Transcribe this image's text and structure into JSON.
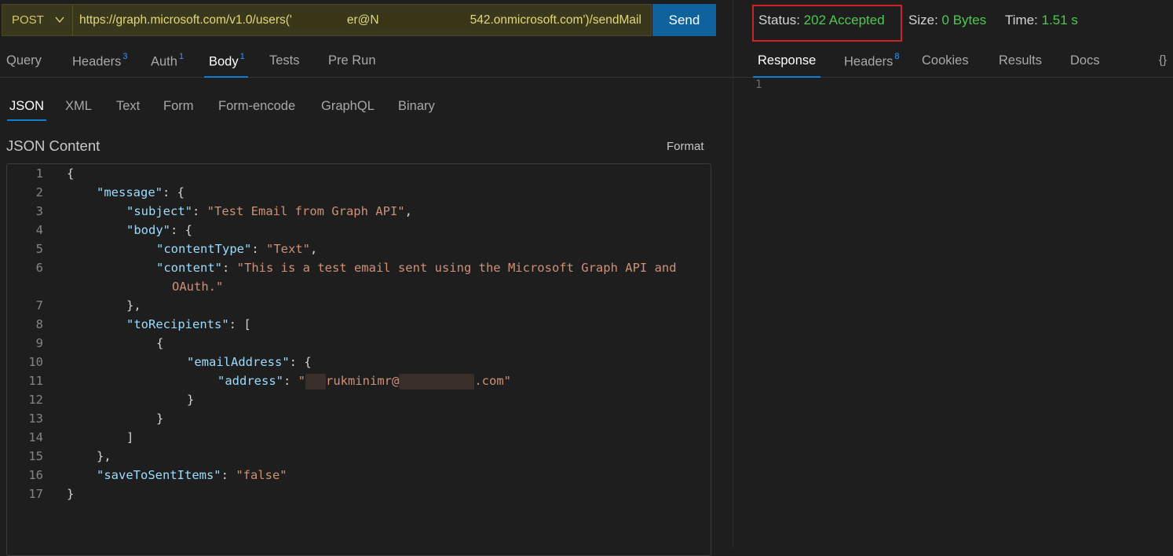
{
  "request": {
    "method": "POST",
    "url_prefix": "https://graph.microsoft.com/v1.0/users('",
    "url_middle1": "er@N",
    "url_middle2": "542.onmicrosoft.com')/sendMail",
    "send_label": "Send"
  },
  "tabs": [
    {
      "label": "Query",
      "badge": ""
    },
    {
      "label": "Headers",
      "badge": "3"
    },
    {
      "label": "Auth",
      "badge": "1"
    },
    {
      "label": "Body",
      "badge": "1"
    },
    {
      "label": "Tests",
      "badge": ""
    },
    {
      "label": "Pre Run",
      "badge": ""
    }
  ],
  "body_tabs": [
    "JSON",
    "XML",
    "Text",
    "Form",
    "Form-encode",
    "GraphQL",
    "Binary"
  ],
  "editor": {
    "title": "JSON Content",
    "format_label": "Format",
    "line_numbers": [
      "1",
      "2",
      "3",
      "4",
      "5",
      "6",
      "7",
      "8",
      "9",
      "10",
      "11",
      "12",
      "13",
      "14",
      "15",
      "16",
      "17"
    ],
    "l1": "{",
    "l2_key": "\"message\"",
    "l2_rest": ": {",
    "l3_key": "\"subject\"",
    "l3_sep": ": ",
    "l3_val": "\"Test Email from Graph API\"",
    "l3_end": ",",
    "l4_key": "\"body\"",
    "l4_rest": ": {",
    "l5_key": "\"contentType\"",
    "l5_sep": ": ",
    "l5_val": "\"Text\"",
    "l5_end": ",",
    "l6_key": "\"content\"",
    "l6_sep": ": ",
    "l6_val": "\"This is a test email sent using the Microsoft Graph API and",
    "l6_wrap": "OAuth.\"",
    "l7": "},",
    "l8_key": "\"toRecipients\"",
    "l8_rest": ": [",
    "l9": "{",
    "l10_key": "\"emailAddress\"",
    "l10_rest": ": {",
    "l11_key": "\"address\"",
    "l11_sep": ": ",
    "l11_q": "\"",
    "l11_mid": "rukminimr@",
    "l11_end": ".com\"",
    "l12": "}",
    "l13": "}",
    "l14": "]",
    "l15": "},",
    "l16_key": "\"saveToSentItems\"",
    "l16_sep": ": ",
    "l16_val": "\"false\"",
    "l17": "}"
  },
  "response": {
    "status_label": "Status:",
    "status_value": "202 Accepted",
    "size_label": "Size:",
    "size_value": "0 Bytes",
    "time_label": "Time:",
    "time_value": "1.51 s",
    "tabs": [
      {
        "label": "Response",
        "badge": ""
      },
      {
        "label": "Headers",
        "badge": "8"
      },
      {
        "label": "Cookies",
        "badge": ""
      },
      {
        "label": "Results",
        "badge": ""
      },
      {
        "label": "Docs",
        "badge": ""
      }
    ],
    "braces_label": "{}",
    "line_1": "1"
  },
  "colors": {
    "accent": "#0e639c",
    "status_ok": "#4ec94e",
    "highlight": "#c5262c"
  },
  "icons": [
    "chevron-down-icon",
    "braces-icon"
  ]
}
